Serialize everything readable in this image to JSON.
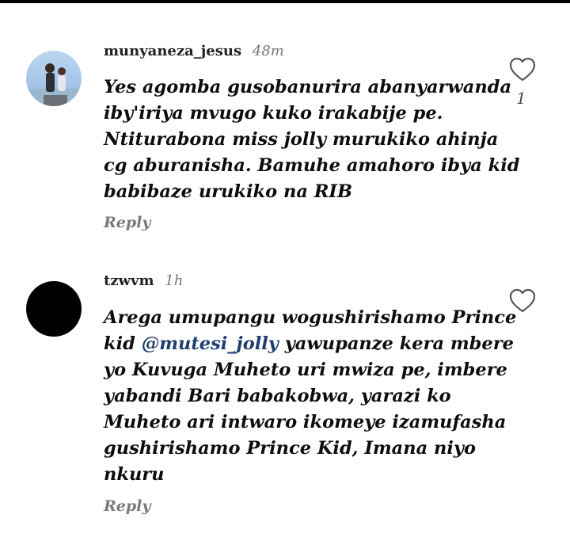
{
  "comments": [
    {
      "username": "munyaneza_jesus",
      "time": "48m",
      "lines": [
        "Yes agomba gusobanurira abanyarwanda",
        "iby'iriya mvugo kuko irakabije pe.",
        "Ntiturabona miss jolly murukiko ahinja",
        "cg aburanisha. Bamuhe amahoro ibya kid",
        "babibaze urukiko na RIB"
      ],
      "like_count": "1",
      "reply_label": "Reply"
    },
    {
      "username": "tzwvm",
      "time": "1h",
      "lines": [
        "Arega umupangu wogushirishamo Prince",
        "kid",
        "@mutesi_jolly",
        "yawupanze kera mbere",
        "yo Kuvuga Muheto uri mwiza pe, imbere",
        "yabandi Bari babakobwa, yarazi ko",
        "Muheto ari intwaro ikomeye izamufasha",
        "gushirishamo Prince Kid, Imana niyo",
        "nkuru"
      ],
      "reply_label": "Reply"
    }
  ],
  "icons": {
    "like": "heart-outline-icon"
  },
  "colors": {
    "mention": "#1f3f70",
    "muted": "#7a7a7a"
  }
}
